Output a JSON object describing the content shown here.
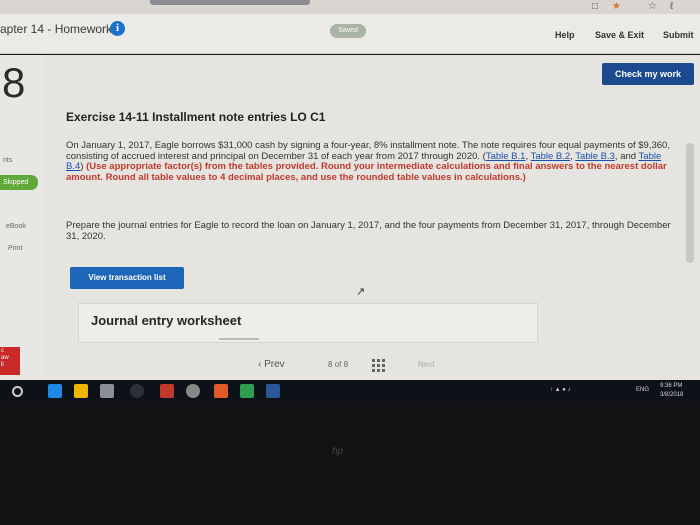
{
  "header": {
    "chapter_title": "apter 14 - Homework",
    "saved": "Saved",
    "help": "Help",
    "save_exit": "Save & Exit",
    "submit": "Submit"
  },
  "sidebar": {
    "question_number": "8",
    "points_label": "nts",
    "skipped_label": "Skipped",
    "ebook_label": "eBook",
    "print_label": "Print"
  },
  "main": {
    "check_my_work": "Check my work",
    "exercise_title": "Exercise 14-11 Installment note entries LO C1",
    "intro_text": "On January 1, 2017, Eagle borrows $31,000 cash by signing a four-year, 8% installment note. The note requires four equal payments of $9,360, consisting of accrued interest and principal on December 31 of each year from 2017 through 2020. (",
    "table_links": [
      "Table B.1",
      "Table B.2",
      "Table B.3",
      "Table B.4"
    ],
    "sep_comma": ", ",
    "sep_and": ", and ",
    "close_paren": ")",
    "instruction_text": " (Use appropriate factor(s) from the tables provided. Round your intermediate calculations and final answers to the nearest dollar amount. Round all table values to 4 decimal places, and use the rounded table values in calculations.)",
    "prepare_text": "Prepare the journal entries for Eagle to record the loan on January 1, 2017, and the four payments from December 31, 2017, through December 31, 2020.",
    "view_transaction_list": "View transaction list",
    "worksheet_title": "Journal entry worksheet"
  },
  "pager": {
    "prev": "Prev",
    "current": "8",
    "of_label": "of",
    "total": "8",
    "next": "Next"
  },
  "taskbar": {
    "time": "9:36 PM",
    "date": "3/8/2018",
    "language": "ENG"
  },
  "colors": {
    "accent_blue": "#1b4b8e",
    "skipped_green": "#5fa83a",
    "instruction_red": "#c43a2a"
  }
}
